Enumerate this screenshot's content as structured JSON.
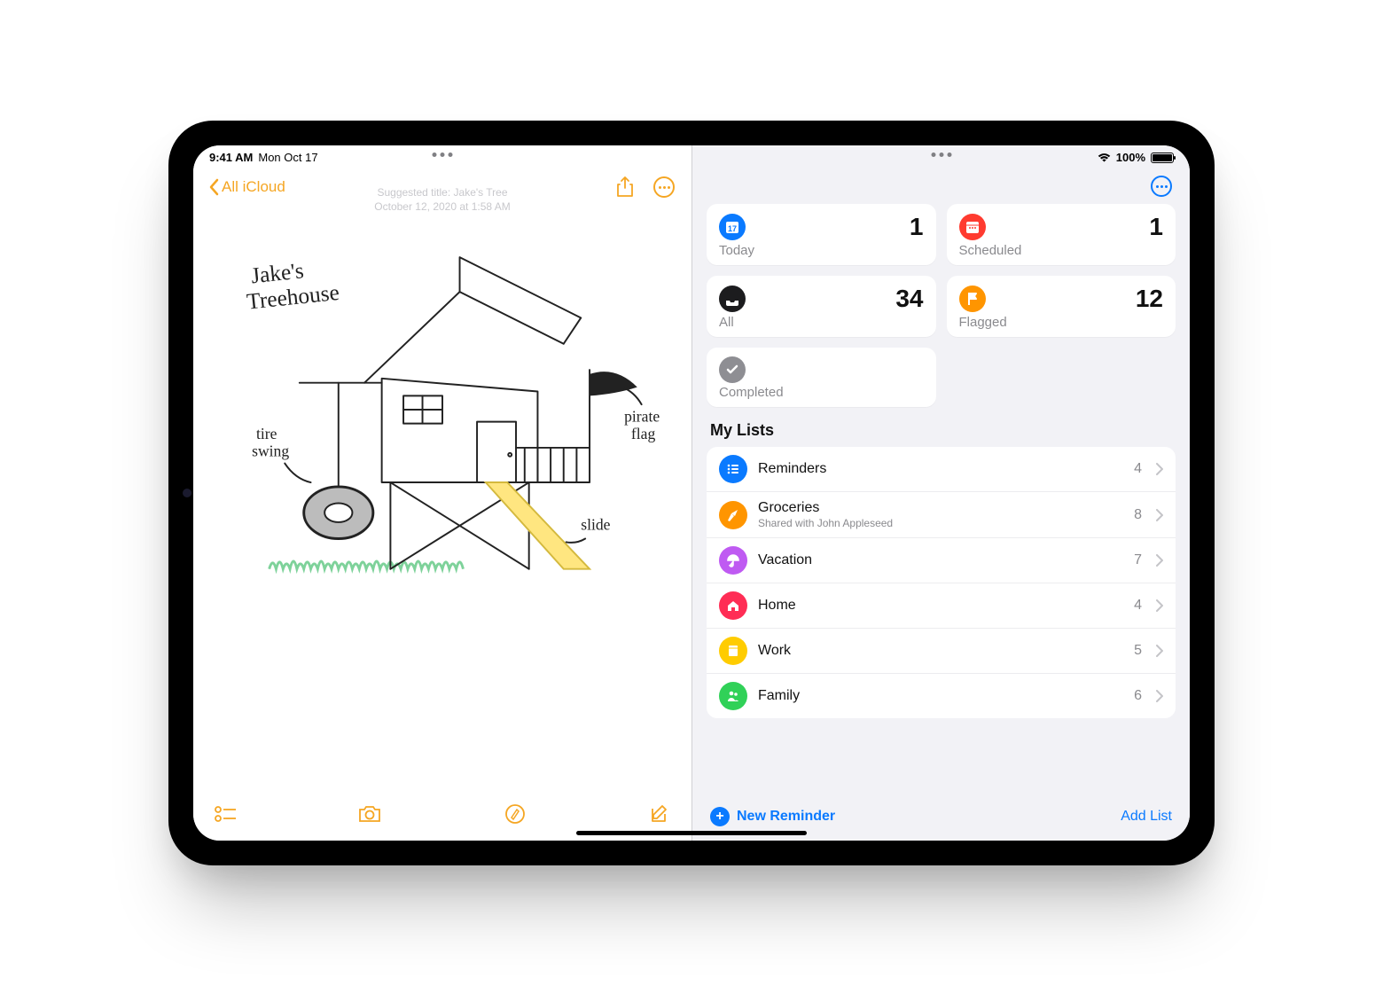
{
  "status": {
    "time": "9:41 AM",
    "date": "Mon Oct 17",
    "battery_pct": "100%"
  },
  "notes": {
    "back_label": "All iCloud",
    "meta_line1": "Suggested title: Jake's Tree",
    "meta_line2": "October 12, 2020 at 1:58 AM",
    "drawing_title": "Jake's Treehouse",
    "labels": {
      "tire_swing": "tire swing",
      "pirate_flag": "pirate flag",
      "slide": "slide"
    }
  },
  "reminders": {
    "smart": {
      "today": {
        "label": "Today",
        "count": "1",
        "color": "#0a7aff"
      },
      "scheduled": {
        "label": "Scheduled",
        "count": "1",
        "color": "#ff3b30"
      },
      "all": {
        "label": "All",
        "count": "34",
        "color": "#1c1c1e"
      },
      "flagged": {
        "label": "Flagged",
        "count": "12",
        "color": "#ff9500"
      },
      "completed": {
        "label": "Completed",
        "count": "",
        "color": "#8e8e93"
      }
    },
    "section_title": "My Lists",
    "lists": [
      {
        "name": "Reminders",
        "sub": "",
        "count": "4",
        "color": "#0a7aff",
        "icon": "list"
      },
      {
        "name": "Groceries",
        "sub": "Shared with John Appleseed",
        "count": "8",
        "color": "#ff9500",
        "icon": "carrot"
      },
      {
        "name": "Vacation",
        "sub": "",
        "count": "7",
        "color": "#bf5af2",
        "icon": "umbrella"
      },
      {
        "name": "Home",
        "sub": "",
        "count": "4",
        "color": "#ff2d55",
        "icon": "home"
      },
      {
        "name": "Work",
        "sub": "",
        "count": "5",
        "color": "#ffcc00",
        "icon": "book"
      },
      {
        "name": "Family",
        "sub": "",
        "count": "6",
        "color": "#30d158",
        "icon": "people"
      }
    ],
    "new_reminder_label": "New Reminder",
    "add_list_label": "Add List"
  }
}
